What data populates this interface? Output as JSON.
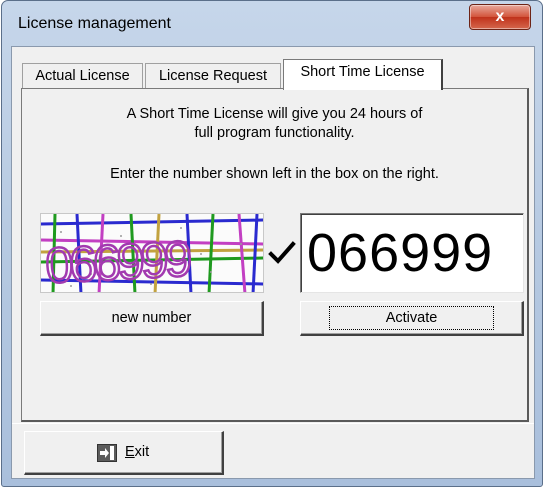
{
  "window": {
    "title": "License management",
    "close_glyph": "x"
  },
  "tabs": [
    {
      "label": "Actual License",
      "active": false
    },
    {
      "label": "License Request",
      "active": false
    },
    {
      "label": "Short Time License",
      "active": true
    }
  ],
  "panel": {
    "info_line1": "A Short Time License will give you 24 hours of",
    "info_line2": "full program functionality.",
    "instruction": "Enter the number shown left in the box on the right.",
    "captcha_digits": "066999",
    "entered_number": "066999",
    "new_number_label": "new number",
    "activate_label": "Activate"
  },
  "footer": {
    "exit_accel": "E",
    "exit_rest": "xit"
  },
  "colors": {
    "title_bar": "#b9cce4",
    "close_red": "#c7402a",
    "face": "#f0f0f0"
  },
  "icons": {
    "close": "close-icon",
    "check": "check-icon",
    "exit": "exit-icon"
  }
}
